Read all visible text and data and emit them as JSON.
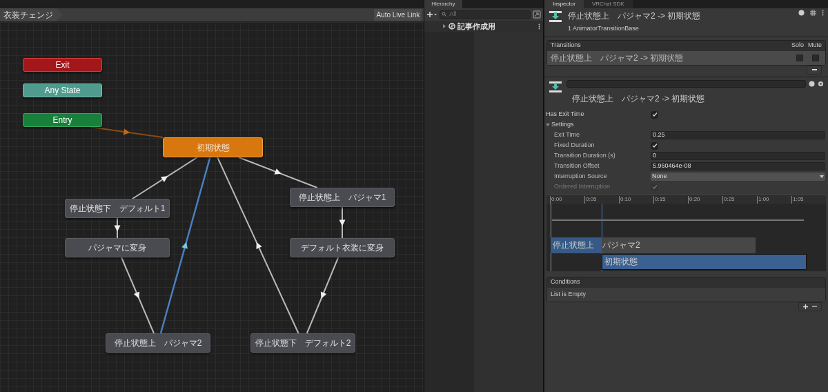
{
  "graph": {
    "breadcrumb": "衣装チェンジ",
    "live_link_button": "Auto Live Link",
    "states": [
      {
        "label": "Exit",
        "kind": "exit"
      },
      {
        "label": "Any State",
        "kind": "any"
      },
      {
        "label": "Entry",
        "kind": "entry"
      },
      {
        "label": "初期状態",
        "kind": "default"
      },
      {
        "label": "停止状態下　デフォルト1",
        "kind": "state"
      },
      {
        "label": "パジャマに変身",
        "kind": "state"
      },
      {
        "label": "停止状態上　パジャマ1",
        "kind": "state"
      },
      {
        "label": "デフォルト衣装に変身",
        "kind": "state"
      },
      {
        "label": "停止状態上　パジャマ2",
        "kind": "state"
      },
      {
        "label": "停止状態下　デフォルト2",
        "kind": "state"
      }
    ],
    "transitions": [
      {
        "kind": "entry"
      },
      {
        "kind": "normal",
        "selected": false
      },
      {
        "kind": "normal",
        "selected": false
      },
      {
        "kind": "normal",
        "selected": false
      },
      {
        "kind": "normal",
        "selected": true
      },
      {
        "kind": "normal",
        "selected": false
      },
      {
        "kind": "normal",
        "selected": false
      },
      {
        "kind": "normal",
        "selected": false
      },
      {
        "kind": "normal",
        "selected": false
      }
    ]
  },
  "hierarchy": {
    "tab": "Hierarchy",
    "search": {
      "placeholder": "All"
    },
    "items": [
      {
        "label": "記事作成用",
        "expanded": false
      }
    ]
  },
  "inspector": {
    "tabs": [
      {
        "label": "Inspector",
        "selected": true
      },
      {
        "label": "VRChat SDK",
        "selected": false
      }
    ],
    "header": {
      "title": "停止状態上　パジャマ2 -> 初期状態",
      "subtitle": "1 AnimatorTransitionBase"
    },
    "transitions": {
      "heading": "Transitions",
      "columns": [
        "Solo",
        "Mute"
      ],
      "rows": [
        {
          "label": "停止状態上　パジャマ2 -> 初期状態",
          "solo": false,
          "mute": false,
          "selected": true
        }
      ]
    },
    "transition": {
      "title": "停止状態上　パジャマ2 -> 初期状態"
    },
    "has_exit_time": {
      "label": "Has Exit Time",
      "checked": true
    },
    "settings": {
      "heading": "Settings",
      "expanded": true,
      "fields": [
        {
          "kind": "text",
          "label": "Exit Time",
          "value": "0.25"
        },
        {
          "kind": "check",
          "label": "Fixed Duration",
          "checked": true,
          "disabled": false
        },
        {
          "kind": "text",
          "label": "Transition Duration (s)",
          "value": "0"
        },
        {
          "kind": "text",
          "label": "Transition Offset",
          "value": "5.960464e-08"
        },
        {
          "kind": "select",
          "label": "Interruption Source",
          "value": "None"
        },
        {
          "kind": "check",
          "label": "Ordered Interruption",
          "checked": true,
          "disabled": true
        }
      ]
    },
    "timeline": {
      "ticks": [
        "0:00",
        "0:05",
        "0:10",
        "0:15",
        "0:20",
        "0:25",
        "1:00",
        "1:05"
      ],
      "bars": [
        {
          "label": "停止状態上　パジャマ2",
          "kind": "source"
        },
        {
          "label": "初期状態",
          "kind": "destination"
        }
      ]
    },
    "conditions": {
      "heading": "Conditions",
      "empty_text": "List is Empty"
    }
  }
}
